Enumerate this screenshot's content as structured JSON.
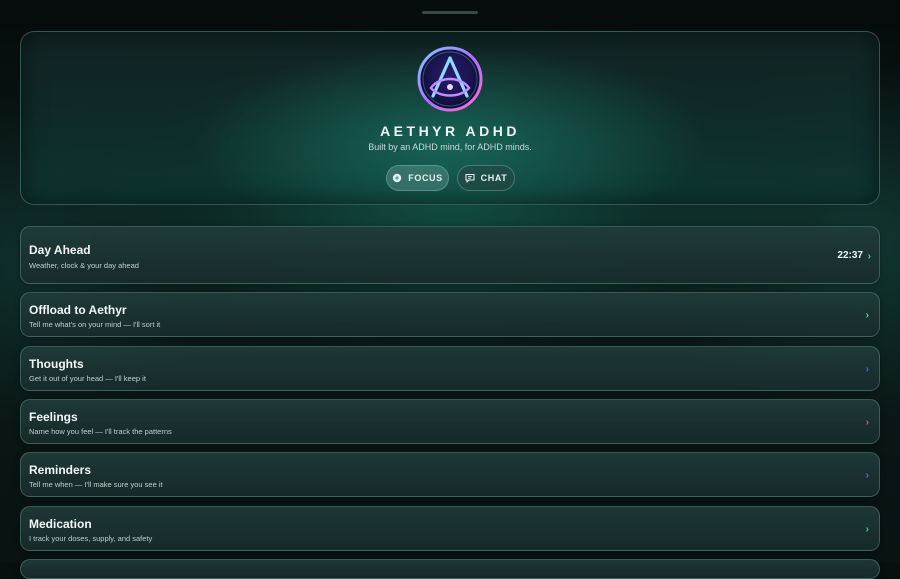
{
  "app": {
    "title": "AETHYR ADHD",
    "tagline": "Built by an ADHD mind, for ADHD minds."
  },
  "mode_buttons": [
    {
      "label": "FOCUS",
      "icon": "focus-icon",
      "active": true
    },
    {
      "label": "CHAT",
      "icon": "chat-bubble-icon",
      "active": false
    }
  ],
  "cards": [
    {
      "title": "Day Ahead",
      "subtitle": "Weather, clock & your day ahead",
      "value": "22:37",
      "chevron": "›",
      "accent": "#4fd1c5"
    },
    {
      "title": "Offload to Aethyr",
      "subtitle": "Tell me what's on your mind — I'll sort it",
      "chevron": "›",
      "accent": "#4fd1c5"
    },
    {
      "title": "Thoughts",
      "subtitle": "Get it out of your head — I'll keep it",
      "chevron": "›",
      "accent": "#4a63d8"
    },
    {
      "title": "Feelings",
      "subtitle": "Name how you feel — I'll track the patterns",
      "chevron": "›",
      "accent": "#e0509a"
    },
    {
      "title": "Reminders",
      "subtitle": "Tell me when — I'll make sure you see it",
      "chevron": "›",
      "accent": "#7b5cf0"
    },
    {
      "title": "Medication",
      "subtitle": "I track your doses, supply, and safety",
      "chevron": "›",
      "accent": "#3fd08a"
    }
  ]
}
